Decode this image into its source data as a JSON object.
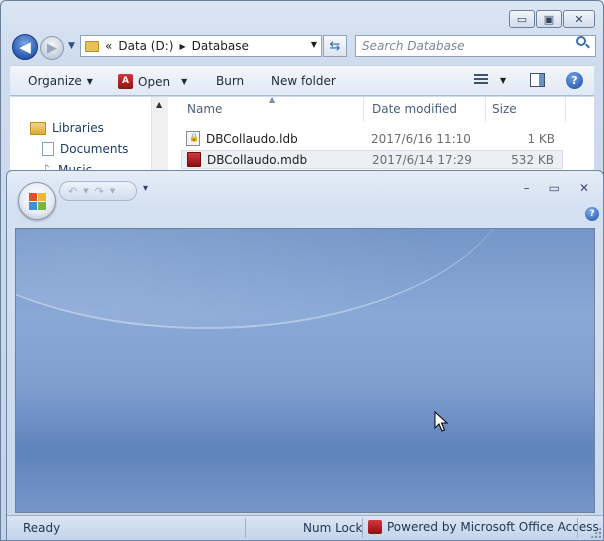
{
  "explorer": {
    "caption": {
      "minimize": "▭",
      "maximize": "▣",
      "close": "✕"
    },
    "address": {
      "chevrons": "«",
      "segments": [
        "Data (D:)",
        "Database"
      ]
    },
    "search": {
      "placeholder": "Search Database"
    },
    "toolbar": {
      "organize": "Organize",
      "open": "Open",
      "burn": "Burn",
      "new_folder": "New folder"
    },
    "nav_pane": {
      "items": [
        "Libraries",
        "Documents",
        "Music"
      ]
    },
    "columns": {
      "name": "Name",
      "date": "Date modified",
      "size": "Size"
    },
    "files": [
      {
        "name": "DBCollaudo.ldb",
        "date": "2017/6/16 11:10",
        "size": "1 KB",
        "icon": "ldb-lock-icon"
      },
      {
        "name": "DBCollaudo.mdb",
        "date": "2017/6/14 17:29",
        "size": "532 KB",
        "icon": "access-db-icon",
        "selected": true
      }
    ]
  },
  "access": {
    "caption": {
      "minimize": "–",
      "maximize": "▭",
      "close": "✕"
    },
    "help": "?",
    "status": {
      "left": "Ready",
      "num_lock": "Num Lock",
      "powered_by": "Powered by Microsoft Office Access"
    }
  },
  "colors": {
    "workspace_blue": "#809fd0",
    "office_accent_red": "#d6353d",
    "explorer_frame": "#cfdcee"
  }
}
